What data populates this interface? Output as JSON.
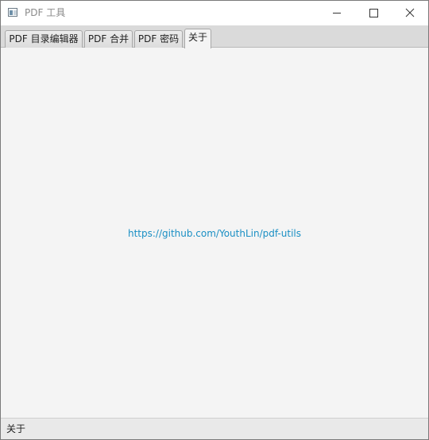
{
  "window": {
    "title": "PDF 工具",
    "icon": "pdf-app-icon"
  },
  "title_buttons": {
    "minimize_icon": "minimize-icon",
    "maximize_icon": "maximize-icon",
    "close_icon": "close-icon"
  },
  "tabs": [
    {
      "label": "PDF 目录编辑器",
      "selected": false
    },
    {
      "label": "PDF 合并",
      "selected": false
    },
    {
      "label": "PDF 密码",
      "selected": false
    },
    {
      "label": "关于",
      "selected": true
    }
  ],
  "main": {
    "link_text": "https://github.com/YouthLin/pdf-utils"
  },
  "status_bar": {
    "text": "关于"
  },
  "colors": {
    "link": "#1a8fc4",
    "background": "#f4f4f4",
    "tab_bar": "#dadada"
  }
}
